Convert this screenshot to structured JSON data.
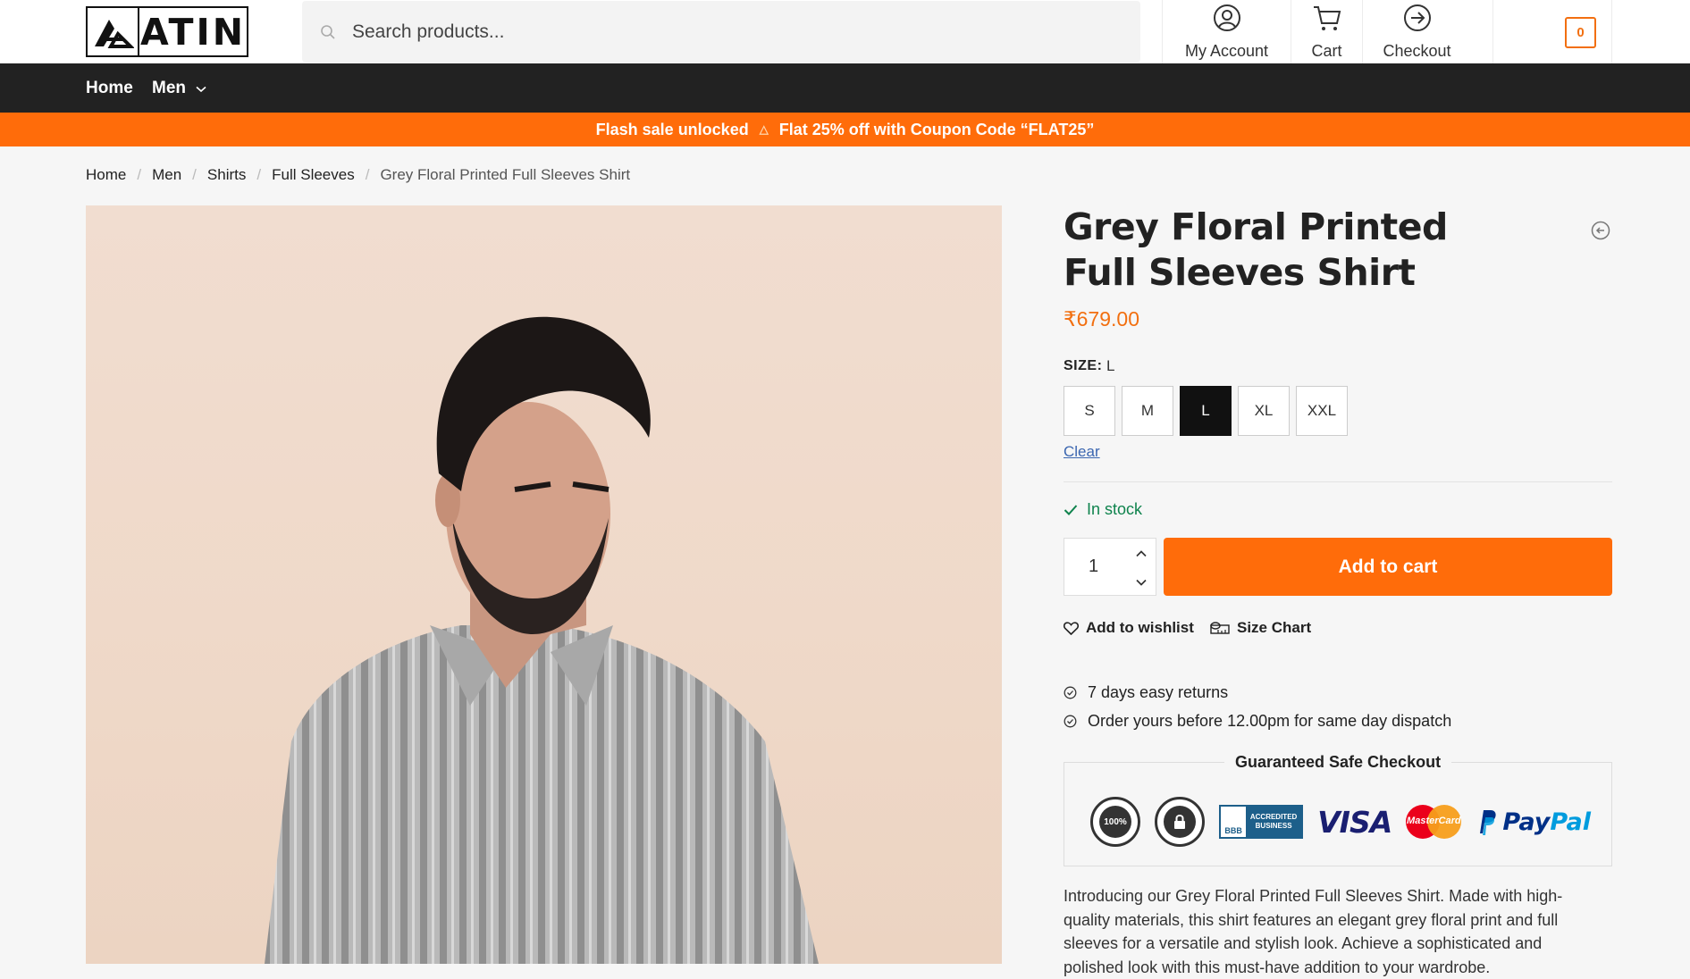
{
  "header": {
    "logo_text": "ATIN",
    "search_placeholder": "Search products...",
    "nav": [
      {
        "label": "My Account",
        "icon": "user-circle-icon"
      },
      {
        "label": "Cart",
        "icon": "cart-icon"
      },
      {
        "label": "Checkout",
        "icon": "arrow-circle-right-icon"
      }
    ],
    "cart_count": "0"
  },
  "navbar": {
    "items": [
      {
        "label": "Home"
      },
      {
        "label": "Men",
        "icon": "chevron-down-icon"
      }
    ]
  },
  "promo": {
    "left": "Flash sale unlocked",
    "right": "Flat 25% off with Coupon Code “FLAT25”",
    "icon": "fire-icon"
  },
  "breadcrumb": [
    {
      "label": "Home"
    },
    {
      "label": "Men"
    },
    {
      "label": "Shirts"
    },
    {
      "label": "Full Sleeves"
    },
    {
      "label": "Grey Floral Printed Full Sleeves Shirt"
    }
  ],
  "product": {
    "title": "Grey Floral Printed Full Sleeves Shirt",
    "price": "₹679.00",
    "size_label": "SIZE:",
    "size_selected": "L",
    "sizes": [
      {
        "label": "S"
      },
      {
        "label": "M"
      },
      {
        "label": "L"
      },
      {
        "label": "XL"
      },
      {
        "label": "XXL"
      }
    ],
    "clear_label": "Clear",
    "stock": "In stock",
    "quantity": "1",
    "add_to_cart": "Add to cart",
    "wishlist": "Add to wishlist",
    "size_chart": "Size Chart",
    "perks": [
      "7 days easy returns",
      "Order yours before 12.00pm for same day dispatch"
    ],
    "safe_checkout_title": "Guaranteed Safe Checkout",
    "badges": {
      "satisfaction": "100%",
      "bbb_left": "BBB",
      "bbb_line1": "ACCREDITED",
      "bbb_line2": "BUSINESS",
      "visa": "VISA",
      "mastercard": "MasterCard",
      "paypal_1": "Pay",
      "paypal_2": "Pal"
    },
    "description": "Introducing our Grey Floral Printed Full Sleeves Shirt. Made with high-quality materials, this shirt features an elegant grey floral print and full sleeves for a versatile and stylish look. Achieve a sophisticated and polished look with this must-have addition to your wardrobe."
  },
  "colors": {
    "accent": "#ff6c0a",
    "price": "#f26f10",
    "stock": "#0f834d",
    "navbar": "#222222"
  }
}
